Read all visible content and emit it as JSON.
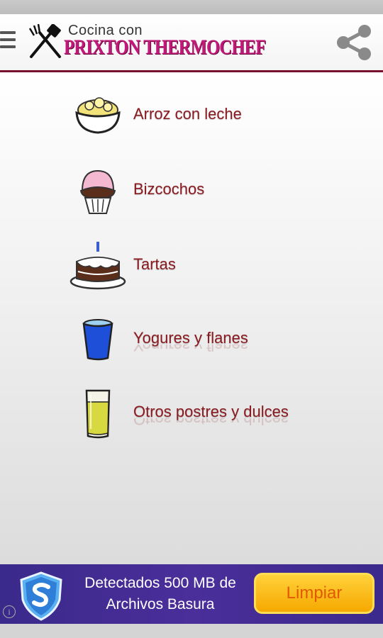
{
  "header": {
    "logo_top": "Cocina con",
    "logo_brand": "PRIXTON THERMOCHEF",
    "accent_color": "#7a1030",
    "brand_color": "#c2187a"
  },
  "menu": {
    "items": [
      {
        "label": "Arroz con leche",
        "icon": "rice-pudding-bowl-icon"
      },
      {
        "label": "Bizcochos",
        "icon": "cupcake-icon"
      },
      {
        "label": "Tartas",
        "icon": "cake-icon"
      },
      {
        "label": "Yogures y flanes",
        "icon": "yogurt-cup-icon"
      },
      {
        "label": "Otros postres y dulces",
        "icon": "glass-icon"
      }
    ],
    "label_color": "#8b1a20"
  },
  "ad": {
    "text_line1": "Detectados 500 MB de",
    "text_line2": "Archivos Basura",
    "button_label": "Limpiar",
    "info_glyph": "i"
  }
}
